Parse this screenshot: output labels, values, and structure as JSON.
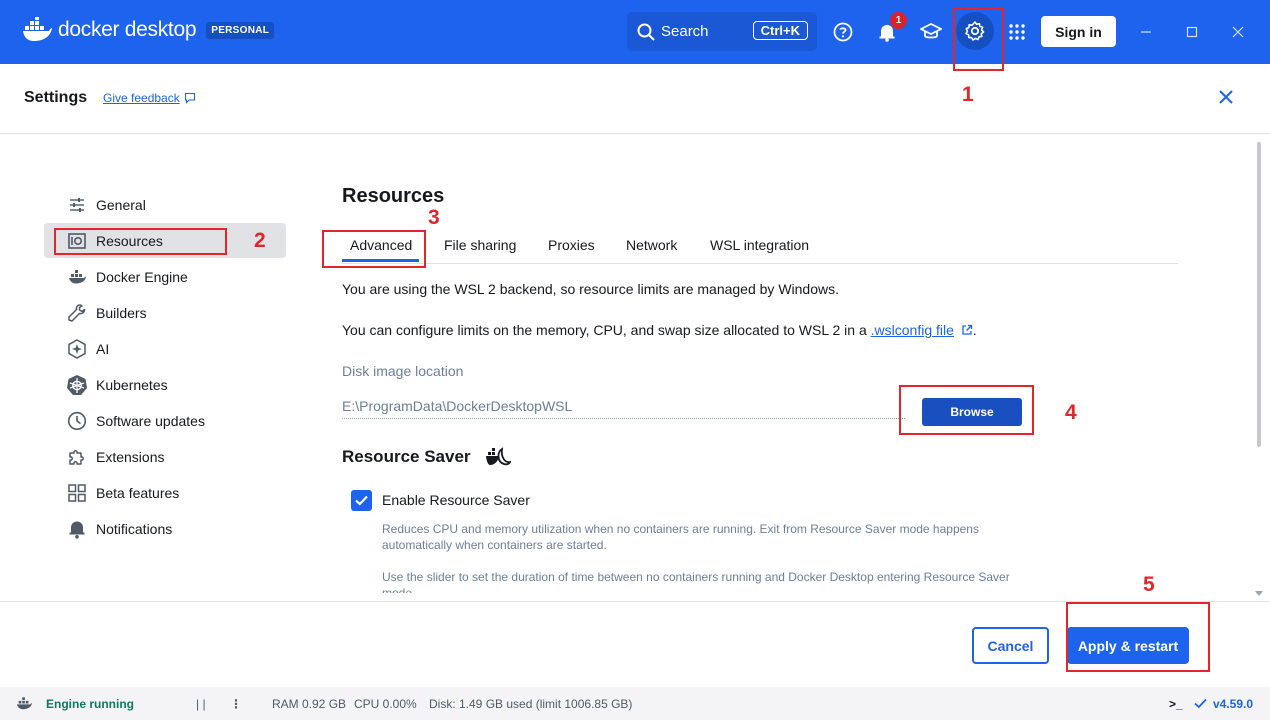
{
  "topbar": {
    "brand": "docker desktop",
    "plan_badge": "PERSONAL",
    "search_label": "Search",
    "search_shortcut": "Ctrl+K",
    "notification_count": "1",
    "sign_in": "Sign in",
    "bg_color": "#1d63ed"
  },
  "settings": {
    "title": "Settings",
    "feedback": "Give feedback"
  },
  "sidebar": {
    "items": [
      {
        "label": "General",
        "icon": "sliders-icon"
      },
      {
        "label": "Resources",
        "icon": "resources-icon",
        "active": true
      },
      {
        "label": "Docker Engine",
        "icon": "whale-icon"
      },
      {
        "label": "Builders",
        "icon": "wrench-icon"
      },
      {
        "label": "AI",
        "icon": "ai-icon"
      },
      {
        "label": "Kubernetes",
        "icon": "helm-icon"
      },
      {
        "label": "Software updates",
        "icon": "clock-icon"
      },
      {
        "label": "Extensions",
        "icon": "puzzle-icon"
      },
      {
        "label": "Beta features",
        "icon": "grid-icon"
      },
      {
        "label": "Notifications",
        "icon": "bell-icon"
      }
    ]
  },
  "content": {
    "title": "Resources",
    "tabs": [
      "Advanced",
      "File sharing",
      "Proxies",
      "Network",
      "WSL integration"
    ],
    "active_tab": "Advanced",
    "wsl_note": "You are using the WSL 2 backend, so resource limits are managed by Windows.",
    "config_note_pre": "You can configure limits on the memory, CPU, and swap size allocated to WSL 2 in a ",
    "config_link": ".wslconfig file",
    "config_note_post": ".",
    "disk_label": "Disk image location",
    "disk_path": "E:\\ProgramData\\DockerDesktopWSL",
    "browse": "Browse",
    "saver_title": "Resource Saver",
    "saver_checkbox": "Enable Resource Saver",
    "saver_checked": true,
    "saver_help1": "Reduces CPU and memory utilization when no containers are running. Exit from Resource Saver mode happens automatically when containers are started.",
    "saver_help2": "Use the slider to set the duration of time between no containers running and Docker Desktop entering Resource Saver mode."
  },
  "footer": {
    "cancel": "Cancel",
    "apply": "Apply & restart"
  },
  "statusbar": {
    "engine": "Engine running",
    "pause": "| |",
    "more": "⋮",
    "ram": "RAM 0.92 GB",
    "cpu": "CPU 0.00%",
    "disk": "Disk: 1.49 GB used (limit 1006.85 GB)",
    "terminal": ">_",
    "version": "v4.59.0"
  },
  "annotations": [
    "1",
    "2",
    "3",
    "4",
    "5"
  ]
}
